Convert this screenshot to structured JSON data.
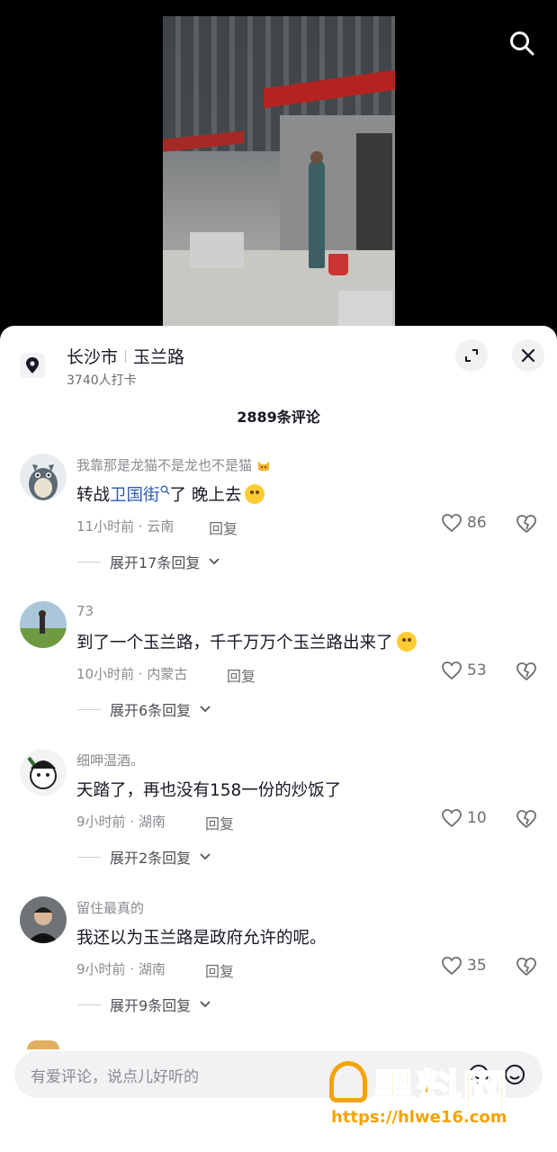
{
  "location": {
    "city": "长沙市",
    "road": "玉兰路",
    "checkins": "3740人打卡"
  },
  "comments_header": "2889条评论",
  "comments": [
    {
      "user": "我靠那是龙猫不是龙也不是猫",
      "text_before": "转战",
      "link": "卫国街",
      "text_after": "了 晚上去",
      "meta": "11小时前 · 云南",
      "reply": "回复",
      "likes": "86",
      "expand": "展开17条回复"
    },
    {
      "user": "73",
      "text": "到了一个玉兰路，千千万万个玉兰路出来了",
      "meta": "10小时前 · 内蒙古",
      "reply": "回复",
      "likes": "53",
      "expand": "展开6条回复"
    },
    {
      "user": "细呷温酒。",
      "text": "天踏了，再也没有158一份的炒饭了",
      "meta": "9小时前 · 湖南",
      "reply": "回复",
      "likes": "10",
      "expand": "展开2条回复"
    },
    {
      "user": "留住最真的",
      "text": "我还以为玉兰路是政府允许的呢。",
      "meta": "9小时前 · 湖南",
      "reply": "回复",
      "likes": "35",
      "expand": "展开9条回复"
    }
  ],
  "input": {
    "placeholder": "有爱评论，说点儿好听的"
  },
  "watermark": {
    "text": "黑料网",
    "url": "https://hlwe16.com"
  }
}
